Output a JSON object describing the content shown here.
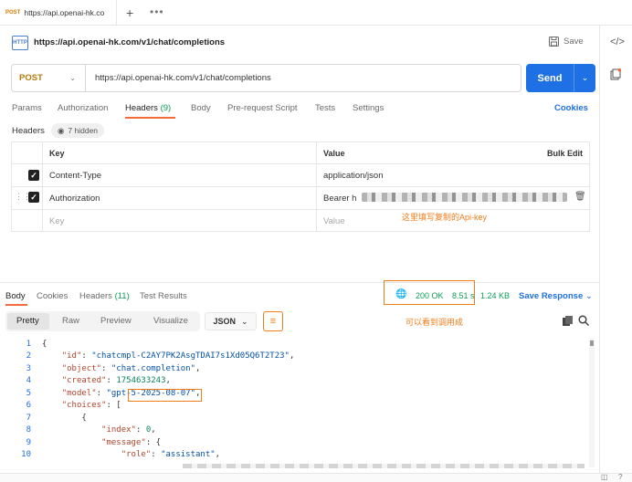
{
  "tab": {
    "method": "POST",
    "name": "https://api.openai-hk.co"
  },
  "icons": {
    "new_tab": "plus-icon",
    "more": "more-dots-icon",
    "code": "code-icon",
    "docs": "docs-icon",
    "save": "save-icon",
    "globe": "globe-icon",
    "copy": "copy-icon",
    "search": "search-icon",
    "wrap": "wrap-icon"
  },
  "request": {
    "title": "https://api.openai-hk.com/v1/chat/completions",
    "save_label": "Save",
    "method": "POST",
    "url": "https://api.openai-hk.com/v1/chat/completions",
    "send_label": "Send",
    "icon_label": "HTTP"
  },
  "request_tabs": [
    {
      "label": "Params"
    },
    {
      "label": "Authorization"
    },
    {
      "label": "Headers",
      "count": "(9)"
    },
    {
      "label": "Body"
    },
    {
      "label": "Pre-request Script"
    },
    {
      "label": "Tests"
    },
    {
      "label": "Settings"
    }
  ],
  "cookies_label": "Cookies",
  "headers": {
    "label": "Headers",
    "hidden": "7 hidden",
    "col_key": "Key",
    "col_value": "Value",
    "bulk_edit": "Bulk Edit",
    "rows": [
      {
        "key": "Content-Type",
        "value": "application/json"
      },
      {
        "key": "Authorization",
        "value": "Bearer h"
      }
    ],
    "placeholder_key": "Key",
    "placeholder_value": "Value"
  },
  "annotations": {
    "api_key": "这里填写复制的Api-key",
    "success": "可以看到调用成"
  },
  "response": {
    "tabs": [
      {
        "label": "Body"
      },
      {
        "label": "Cookies"
      },
      {
        "label": "Headers",
        "count": "(11)"
      },
      {
        "label": "Test Results"
      }
    ],
    "status": "200 OK",
    "time": "8.51 s",
    "size": "1.24 KB",
    "save_response": "Save Response",
    "formats": [
      "Pretty",
      "Raw",
      "Preview",
      "Visualize"
    ],
    "format_type": "JSON"
  },
  "code_lines": [
    {
      "n": "1",
      "text": "{"
    },
    {
      "n": "2",
      "text": "    \"id\": \"chatcmpl-C2AY7PK2AsgTDAI7s1Xd05Q6T2T23\","
    },
    {
      "n": "3",
      "text": "    \"object\": \"chat.completion\","
    },
    {
      "n": "4",
      "text": "    \"created\": 1754633243,"
    },
    {
      "n": "5",
      "text": "    \"model\": \"gpt-5-2025-08-07\","
    },
    {
      "n": "6",
      "text": "    \"choices\": ["
    },
    {
      "n": "7",
      "text": "        {"
    },
    {
      "n": "8",
      "text": "            \"index\": 0,"
    },
    {
      "n": "9",
      "text": "            \"message\": {"
    },
    {
      "n": "10",
      "text": "                \"role\": \"assistant\","
    }
  ]
}
